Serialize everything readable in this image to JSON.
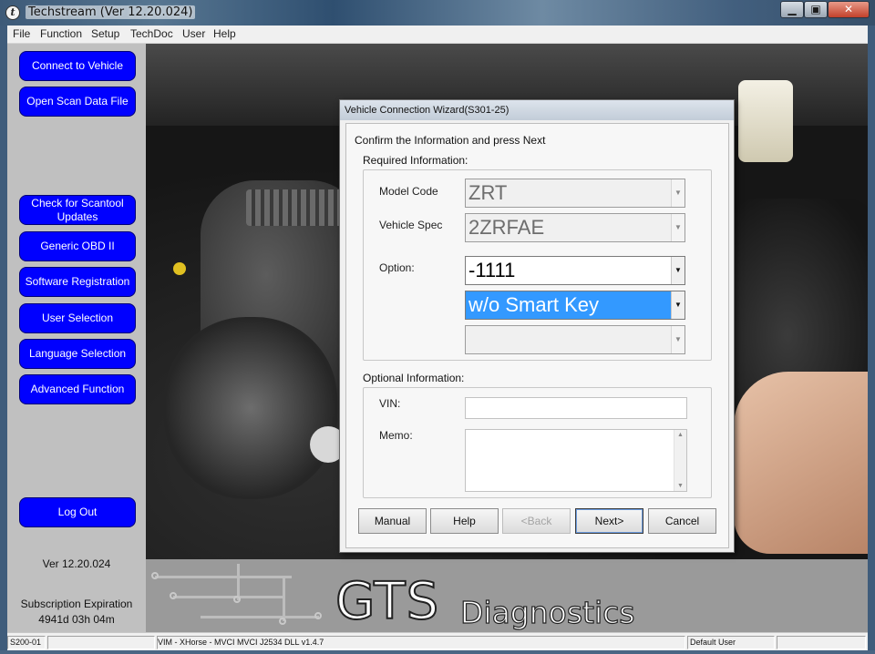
{
  "window": {
    "title": "Techstream (Ver 12.20.024)",
    "controls": {
      "minimize": "▁",
      "maximize": "▣",
      "close": "✕"
    }
  },
  "menu": [
    "File",
    "Function",
    "Setup",
    "TechDoc",
    "User",
    "Help"
  ],
  "sidebar": {
    "buttons": [
      {
        "label": "Connect to Vehicle"
      },
      {
        "label": "Open Scan Data File"
      },
      {
        "label": "Check for Scantool Updates"
      },
      {
        "label": "Generic OBD II"
      },
      {
        "label": "Software Registration"
      },
      {
        "label": "User Selection"
      },
      {
        "label": "Language Selection"
      },
      {
        "label": "Advanced Function"
      },
      {
        "label": "Log Out"
      }
    ],
    "version": "Ver 12.20.024",
    "subscription_label": "Subscription Expiration",
    "subscription_remaining": "4941d 03h 04m"
  },
  "branding": {
    "primary": "GTS",
    "secondary": "Diagnostics"
  },
  "dialog": {
    "title": "Vehicle Connection Wizard(S301-25)",
    "instruction": "Confirm the Information and press Next",
    "required_label": "Required Information:",
    "fields": {
      "model_code": {
        "label": "Model Code",
        "value": "ZRT"
      },
      "vehicle_spec": {
        "label": "Vehicle Spec",
        "value": "2ZRFAE"
      },
      "option": {
        "label": "Option:",
        "value": "-1111"
      },
      "option2": {
        "value": "w/o Smart Key"
      },
      "option3": {
        "value": ""
      }
    },
    "optional_label": "Optional Information:",
    "vin": {
      "label": "VIN:",
      "value": ""
    },
    "memo": {
      "label": "Memo:",
      "value": ""
    },
    "buttons": {
      "manual": "Manual",
      "help": "Help",
      "back": "<Back",
      "next": "Next>",
      "cancel": "Cancel"
    }
  },
  "statusbar": {
    "code": "S200-01",
    "interface": "VIM - XHorse - MVCI MVCI J2534 DLL v1.4.7",
    "user": "Default User"
  },
  "colors": {
    "nav_button": "#0000ff",
    "selection": "#3399ff",
    "panel": "#c0c0c0"
  }
}
